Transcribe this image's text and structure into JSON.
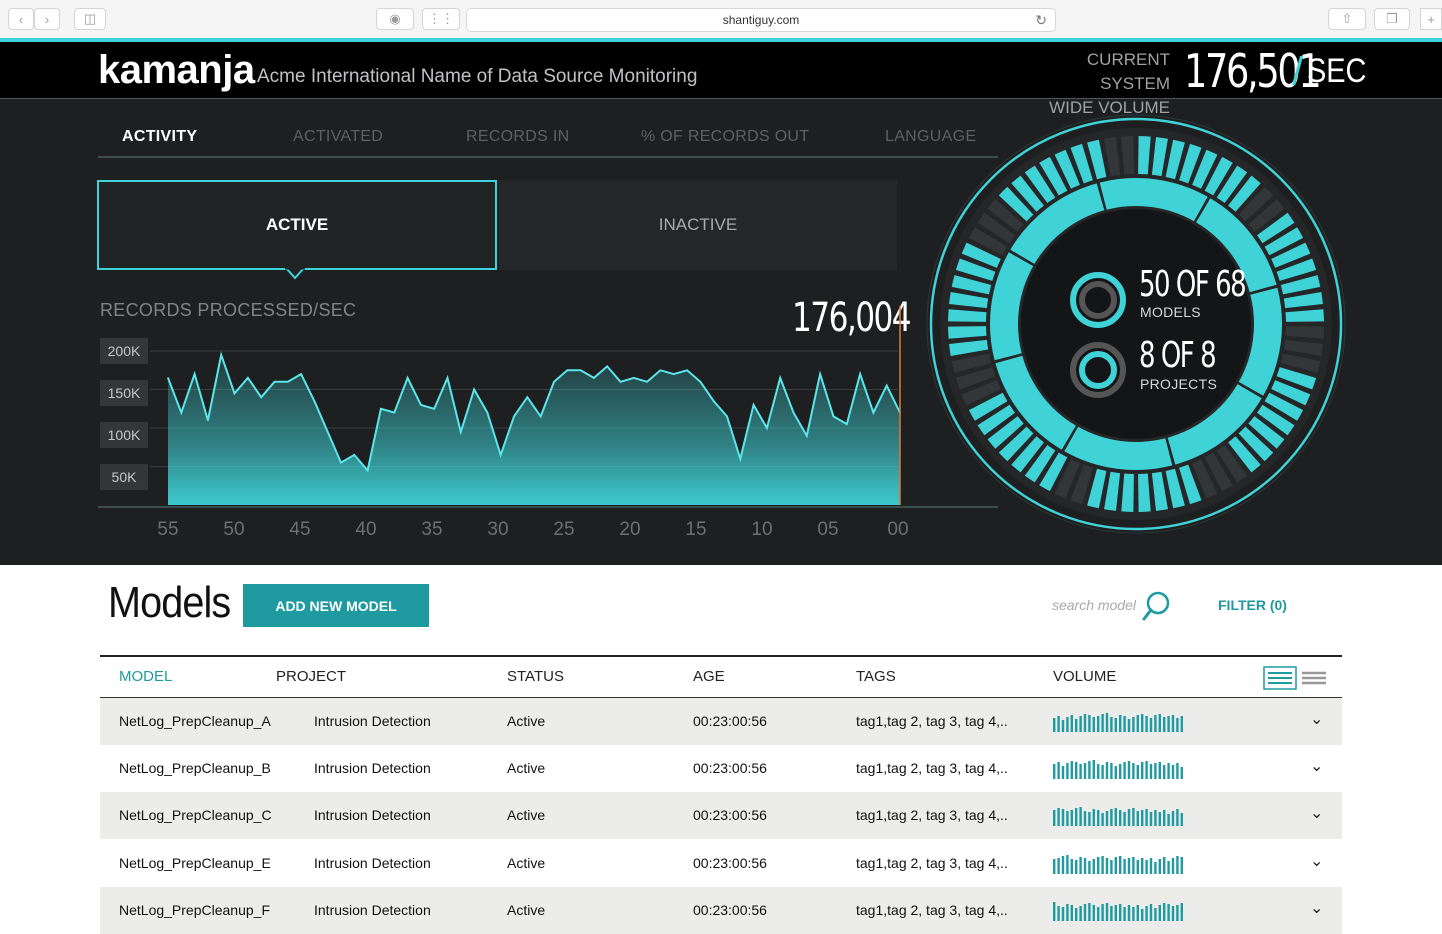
{
  "browser": {
    "url": "shantiguy.com"
  },
  "header": {
    "logo": "kamanja",
    "subtitle": "Acme International Name of Data Source Monitoring",
    "volume_label_1": "CURRENT SYSTEM",
    "volume_label_2": "WIDE VOLUME",
    "volume_value": "176,501",
    "volume_slash": "/",
    "volume_unit": "SEC"
  },
  "tabs": [
    "ACTIVITY",
    "ACTIVATED",
    "RECORDS IN",
    "% OF RECORDS OUT",
    "LANGUAGE"
  ],
  "toggle": {
    "active": "ACTIVE",
    "inactive": "INACTIVE"
  },
  "chart": {
    "title": "RECORDS PROCESSED/SEC",
    "current_value": "176,004",
    "y_ticks": [
      "200K",
      "150K",
      "100K",
      "50K"
    ],
    "x_ticks": [
      "55",
      "50",
      "45",
      "40",
      "35",
      "30",
      "25",
      "20",
      "15",
      "10",
      "05",
      "00"
    ]
  },
  "chart_data": {
    "type": "area",
    "title": "RECORDS PROCESSED/SEC",
    "x": [
      55,
      54,
      53,
      52,
      51,
      50,
      49,
      48,
      47,
      46,
      45,
      44,
      43,
      42,
      41,
      40,
      39,
      38,
      37,
      36,
      35,
      34,
      33,
      32,
      31,
      30,
      29,
      28,
      27,
      26,
      25,
      24,
      23,
      22,
      21,
      20,
      19,
      18,
      17,
      16,
      15,
      14,
      13,
      12,
      11,
      10,
      9,
      8,
      7,
      6,
      5,
      4,
      3,
      2,
      1,
      0
    ],
    "y": [
      165000,
      120000,
      170000,
      110000,
      195000,
      145000,
      165000,
      140000,
      160000,
      160000,
      170000,
      135000,
      95000,
      55000,
      65000,
      45000,
      125000,
      120000,
      165000,
      130000,
      125000,
      165000,
      95000,
      150000,
      120000,
      65000,
      115000,
      140000,
      115000,
      160000,
      175000,
      175000,
      165000,
      180000,
      160000,
      165000,
      160000,
      175000,
      170000,
      175000,
      160000,
      135000,
      115000,
      60000,
      130000,
      100000,
      165000,
      120000,
      90000,
      170000,
      115000,
      105000,
      170000,
      120000,
      155000,
      120000
    ],
    "ylabel": "",
    "xlabel": "",
    "ylim": [
      0,
      250000
    ],
    "color": "#3fd2d6"
  },
  "ring": {
    "models_value": "50 OF 68",
    "models_label": "MODELS",
    "projects_value": "8 OF 8",
    "projects_label": "PROJECTS",
    "models_fraction": 0.735,
    "projects_fraction": 1.0
  },
  "models": {
    "title": "Models",
    "add_label": "ADD NEW MODEL",
    "search_placeholder": "search model",
    "filter_label": "FILTER (0)",
    "columns": [
      "MODEL",
      "PROJECT",
      "STATUS",
      "AGE",
      "TAGS",
      "VOLUME"
    ],
    "rows": [
      {
        "model": "NetLog_PrepCleanup_A",
        "project": "Intrusion Detection",
        "status": "Active",
        "age": "00:23:00:56",
        "tags": "tag1,tag 2, tag 3, tag 4,.."
      },
      {
        "model": "NetLog_PrepCleanup_B",
        "project": "Intrusion Detection",
        "status": "Active",
        "age": "00:23:00:56",
        "tags": "tag1,tag 2, tag 3, tag 4,.."
      },
      {
        "model": "NetLog_PrepCleanup_C",
        "project": "Intrusion Detection",
        "status": "Active",
        "age": "00:23:00:56",
        "tags": "tag1,tag 2, tag 3, tag 4,.."
      },
      {
        "model": "NetLog_PrepCleanup_E",
        "project": "Intrusion Detection",
        "status": "Active",
        "age": "00:23:00:56",
        "tags": "tag1,tag 2, tag 3, tag 4,.."
      },
      {
        "model": "NetLog_PrepCleanup_F",
        "project": "Intrusion Detection",
        "status": "Active",
        "age": "00:23:00:56",
        "tags": "tag1,tag 2, tag 3, tag 4,.."
      }
    ]
  },
  "colors": {
    "accent": "#3fd2d6",
    "teal_dark": "#1e9aa0"
  }
}
